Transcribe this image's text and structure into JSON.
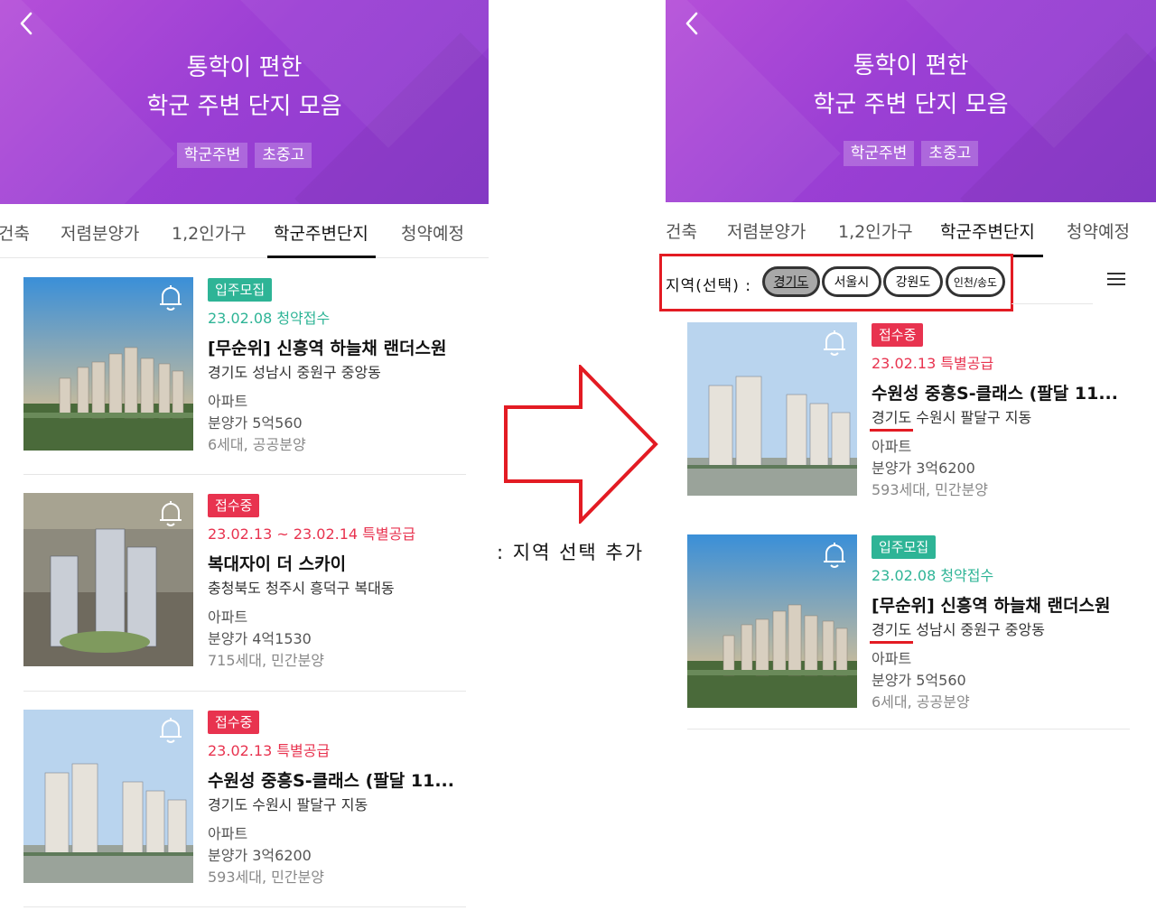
{
  "hero": {
    "title_line1": "통학이 편한",
    "title_line2": "학군 주변 단지 모음",
    "tags": [
      "학군주변",
      "초중고"
    ],
    "gradient": [
      "#b54fd8",
      "#8a3ccc"
    ]
  },
  "tabs": [
    "건축",
    "저렴분양가",
    "1,2인가구",
    "학군주변단지",
    "청약예정"
  ],
  "active_tab": "학군주변단지",
  "region_filter": {
    "label": "지역(선택) :",
    "options": [
      "경기도",
      "서울시",
      "강원도",
      "인천/송도"
    ],
    "selected": "경기도"
  },
  "annotation": {
    "caption": ": 지역 선택 추가",
    "arrow_color": "#e31b23"
  },
  "left_list": [
    {
      "badge": "입주모집",
      "badge_color": "#2eb496",
      "date_line": "23.02.08 청약접수",
      "name": "[무순위] 신흥역 하늘채 랜더스원",
      "address": "경기도 성남시 중원구 중앙동",
      "type": "아파트",
      "price": "분양가 5억560",
      "units": "6세대, 공공분양"
    },
    {
      "badge": "접수중",
      "badge_color": "#e8334f",
      "date_line": "23.02.13 ~ 23.02.14 특별공급",
      "name": "복대자이 더 스카이",
      "address": "충청북도 청주시 흥덕구 복대동",
      "type": "아파트",
      "price": "분양가 4억1530",
      "units": "715세대, 민간분양"
    },
    {
      "badge": "접수중",
      "badge_color": "#e8334f",
      "date_line": "23.02.13 특별공급",
      "name": "수원성 중흥S-클래스 (팔달 11...",
      "address": "경기도 수원시 팔달구 지동",
      "type": "아파트",
      "price": "분양가 3억6200",
      "units": "593세대, 민간분양"
    }
  ],
  "right_list": [
    {
      "badge": "접수중",
      "badge_color": "#e8334f",
      "date_line": "23.02.13 특별공급",
      "name": "수원성 중흥S-클래스 (팔달 11...",
      "address_region": "경기도",
      "address_rest": " 수원시 팔달구 지동",
      "type": "아파트",
      "price": "분양가 3억6200",
      "units": "593세대, 민간분양"
    },
    {
      "badge": "입주모집",
      "badge_color": "#2eb496",
      "date_line": "23.02.08 청약접수",
      "name": "[무순위] 신흥역 하늘채 랜더스원",
      "address_region": "경기도",
      "address_rest": " 성남시 중원구 중앙동",
      "type": "아파트",
      "price": "분양가 5억560",
      "units": "6세대, 공공분양"
    }
  ]
}
